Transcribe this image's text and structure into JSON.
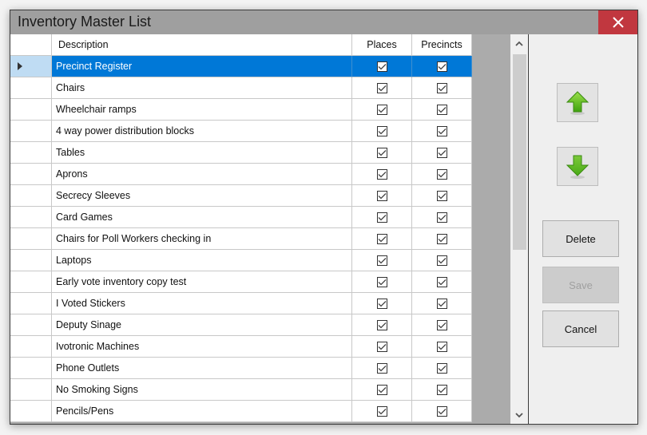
{
  "window": {
    "title": "Inventory Master List",
    "close_icon": "close-x-icon",
    "colors": {
      "titlebar": "#9f9f9f",
      "close": "#c1373f",
      "selection": "#0078d7"
    }
  },
  "grid": {
    "columns": [
      {
        "key": "description",
        "label": "Description"
      },
      {
        "key": "places",
        "label": "Places"
      },
      {
        "key": "precincts",
        "label": "Precincts"
      }
    ],
    "selected_index": 0,
    "rows": [
      {
        "description": "Precinct Register",
        "places": true,
        "precincts": true
      },
      {
        "description": "Chairs",
        "places": true,
        "precincts": true
      },
      {
        "description": "Wheelchair ramps",
        "places": true,
        "precincts": true
      },
      {
        "description": "4 way power distribution blocks",
        "places": true,
        "precincts": true
      },
      {
        "description": "Tables",
        "places": true,
        "precincts": true
      },
      {
        "description": "Aprons",
        "places": true,
        "precincts": true
      },
      {
        "description": "Secrecy Sleeves",
        "places": true,
        "precincts": true
      },
      {
        "description": "Card Games",
        "places": true,
        "precincts": true
      },
      {
        "description": "Chairs for Poll Workers checking in",
        "places": true,
        "precincts": true
      },
      {
        "description": "Laptops",
        "places": true,
        "precincts": true
      },
      {
        "description": "Early vote inventory copy test",
        "places": true,
        "precincts": true
      },
      {
        "description": "I Voted Stickers",
        "places": true,
        "precincts": true
      },
      {
        "description": "Deputy Sinage",
        "places": true,
        "precincts": true
      },
      {
        "description": "Ivotronic Machines",
        "places": true,
        "precincts": true
      },
      {
        "description": "Phone Outlets",
        "places": true,
        "precincts": true
      },
      {
        "description": "No Smoking Signs",
        "places": true,
        "precincts": true
      },
      {
        "description": "Pencils/Pens",
        "places": true,
        "precincts": true
      }
    ]
  },
  "panel": {
    "move_up_icon": "green-up-arrow-icon",
    "move_down_icon": "green-down-arrow-icon",
    "delete_label": "Delete",
    "save_label": "Save",
    "save_enabled": false,
    "cancel_label": "Cancel"
  }
}
